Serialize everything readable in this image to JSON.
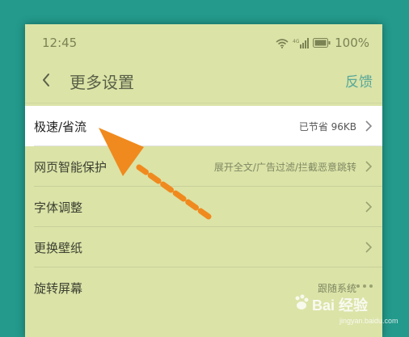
{
  "status_bar": {
    "time": "12:45",
    "battery": "100%"
  },
  "header": {
    "title": "更多设置",
    "feedback": "反馈"
  },
  "settings": [
    {
      "label": "极速/省流",
      "value": "已节省 96KB",
      "highlight": true
    },
    {
      "label": "网页智能保护",
      "value": "展开全文/广告过滤/拦截恶意跳转"
    },
    {
      "label": "字体调整",
      "value": ""
    },
    {
      "label": "更换壁纸",
      "value": ""
    },
    {
      "label": "旋转屏幕",
      "value": "跟随系统"
    }
  ],
  "watermark": {
    "brand": "Bai 经验",
    "sub": "jingyan.baidu.com"
  },
  "colors": {
    "background": "#239a8c",
    "screen": "#dbe3a7",
    "accent": "#58a899",
    "arrow": "#f08a1e"
  },
  "icons": [
    "wifi-icon",
    "signal-icon",
    "battery-icon",
    "back-icon",
    "chevron-right-icon",
    "more-icon",
    "arrow-pointer-icon"
  ]
}
